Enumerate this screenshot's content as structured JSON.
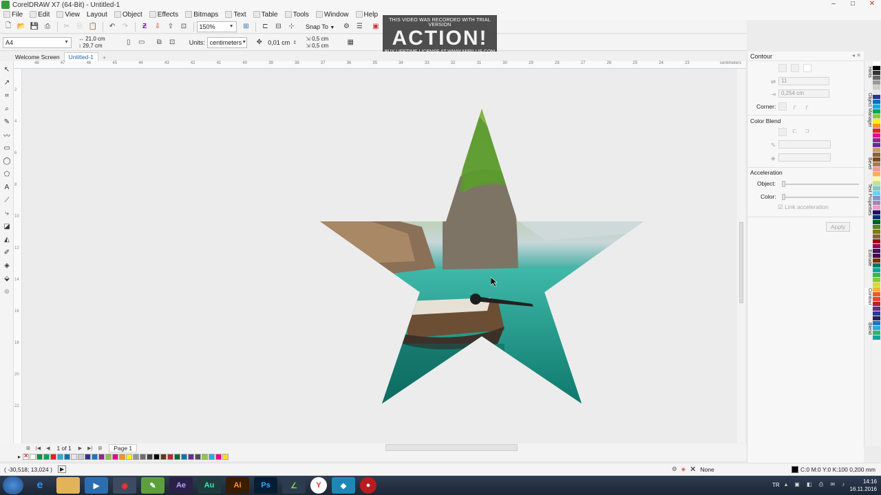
{
  "app": {
    "title": "CorelDRAW X7 (64-Bit) - Untitled-1",
    "window_controls": [
      "–",
      "□",
      "✕"
    ]
  },
  "menu": [
    "File",
    "Edit",
    "View",
    "Layout",
    "Object",
    "Effects",
    "Bitmaps",
    "Text",
    "Table",
    "Tools",
    "Window",
    "Help"
  ],
  "toolbar1": {
    "zoom": "150%",
    "snap_to": "Snap To"
  },
  "toolbar2": {
    "page_size": "A4",
    "width": "21,0 cm",
    "height": "29,7 cm",
    "units_label": "Units:",
    "units": "centimeters",
    "nudge": "0,01 cm",
    "dup_x": "0,5 cm",
    "dup_y": "0,5 cm"
  },
  "watermark": {
    "line1": "THIS VIDEO WAS RECORDED WITH TRIAL VERSION",
    "logo": "ACTION!",
    "line2": "BUY LIFETIME LICENSE AT WWW.MIRILLIS.COM"
  },
  "tabs": [
    "Welcome Screen",
    "Untitled-1"
  ],
  "ruler": {
    "ticks": [
      "48",
      "47",
      "46",
      "45",
      "44",
      "43",
      "42",
      "41",
      "40",
      "39",
      "38",
      "37",
      "36",
      "35",
      "34",
      "33",
      "32",
      "31",
      "30",
      "29",
      "28",
      "27",
      "26",
      "25",
      "24",
      "23"
    ],
    "unit": "centimeters",
    "vticks": [
      "2",
      "4",
      "6",
      "8",
      "10",
      "12",
      "14",
      "16",
      "18",
      "20",
      "22"
    ]
  },
  "pagenav": {
    "count": "1 of 1",
    "page": "Page 1"
  },
  "palette_bottom": [
    "#ffffff",
    "#009245",
    "#00a651",
    "#ed1c24",
    "#29abe2",
    "#0072bc",
    "#e6e6e6",
    "#cccccc",
    "#2e3192",
    "#1b75bc",
    "#92278f",
    "#8dc63f",
    "#ec008c",
    "#f7941d",
    "#fff200",
    "#939598",
    "#6d6e71",
    "#414042",
    "#000000",
    "#603913",
    "#c1272d",
    "#006837",
    "#0071bc",
    "#662d91",
    "#4d4d4d",
    "#8cc63f",
    "#27aae1",
    "#ed008c",
    "#ffde17"
  ],
  "palette_right": [
    "#ffffff",
    "#000000",
    "#333333",
    "#666666",
    "#999999",
    "#cccccc",
    "#e6e6e6",
    "#2e3192",
    "#0072bc",
    "#00aeef",
    "#00a651",
    "#8dc63f",
    "#fff200",
    "#f7941d",
    "#ed1c24",
    "#ec008c",
    "#92278f",
    "#662d91",
    "#c69c6d",
    "#8c6239",
    "#754c24",
    "#a67c52",
    "#f5989d",
    "#fbaf5d",
    "#fff799",
    "#c4df9b",
    "#7accc8",
    "#6dcff6",
    "#8393ca",
    "#a187be",
    "#f49ac1",
    "#1b1464",
    "#003471",
    "#005e20",
    "#598527",
    "#827b00",
    "#8c6239",
    "#9e0b0f",
    "#9e005d",
    "#440e62",
    "#4b0049",
    "#7b2e00",
    "#00746b",
    "#00a99d",
    "#39b54a",
    "#8cc63f",
    "#d7df23",
    "#fbb040",
    "#f15a29",
    "#ef4136",
    "#be1e2d",
    "#662d91",
    "#2b3990",
    "#262262",
    "#1c75bc",
    "#27aae1",
    "#2bb673",
    "#00a79d"
  ],
  "status": {
    "coords": "( -30,518; 13,024 )",
    "fill": "None",
    "outline": "C:0 M:0 Y:0 K:100  0,200 mm"
  },
  "taskbar": {
    "apps": [
      "e",
      "",
      "",
      "",
      "",
      "Ae",
      "Au",
      "Ai",
      "Ps",
      "",
      "Y",
      "",
      ""
    ],
    "lang": "TR",
    "time": "14:16",
    "date": "16.11.2016"
  },
  "docker": {
    "title": "Contour",
    "steps": "11",
    "offset": "0,254 cm",
    "corner_label": "Corner:",
    "color_blend_label": "Color Blend",
    "acceleration_label": "Acceleration",
    "object_label": "Object:",
    "color_label": "Color:",
    "link_label": "Link acceleration",
    "apply_label": "Apply"
  },
  "docker_tabs": [
    "Hints",
    "Object Manager",
    "Bevel",
    "Text Properties",
    "Extrude",
    "Contour",
    "Blend"
  ]
}
